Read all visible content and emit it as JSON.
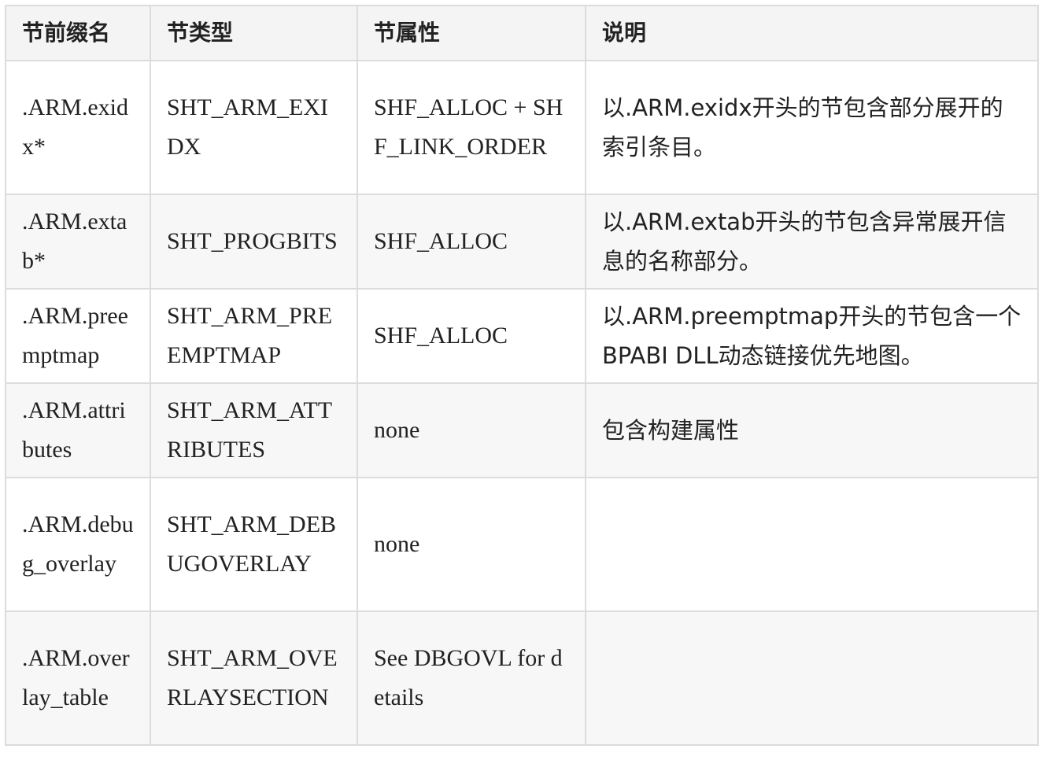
{
  "table": {
    "headers": [
      "节前缀名",
      "节类型",
      "节属性",
      "说明"
    ],
    "rows": [
      [
        ".ARM.exidx*",
        "SHT_ARM_EXIDX",
        "SHF_ALLOC + SHF_LINK_ORDER",
        "以.ARM.exidx开头的节包含部分展开的索引条目。"
      ],
      [
        ".ARM.extab*",
        "SHT_PROGBITS",
        "SHF_ALLOC",
        "以.ARM.extab开头的节包含异常展开信息的名称部分。"
      ],
      [
        ".ARM.preemptmap",
        "SHT_ARM_PREEMPTMAP",
        "SHF_ALLOC",
        "以.ARM.preemptmap开头的节包含一个BPABI DLL动态链接优先地图。"
      ],
      [
        ".ARM.attributes",
        "SHT_ARM_ATTRIBUTES",
        "none",
        "包含构建属性"
      ],
      [
        ".ARM.debug_overlay",
        "SHT_ARM_DEBUGOVERLAY",
        "none",
        ""
      ],
      [
        ".ARM.overlay_table",
        "SHT_ARM_OVERLAYSECTION",
        "See DBGOVL for details",
        ""
      ]
    ]
  }
}
